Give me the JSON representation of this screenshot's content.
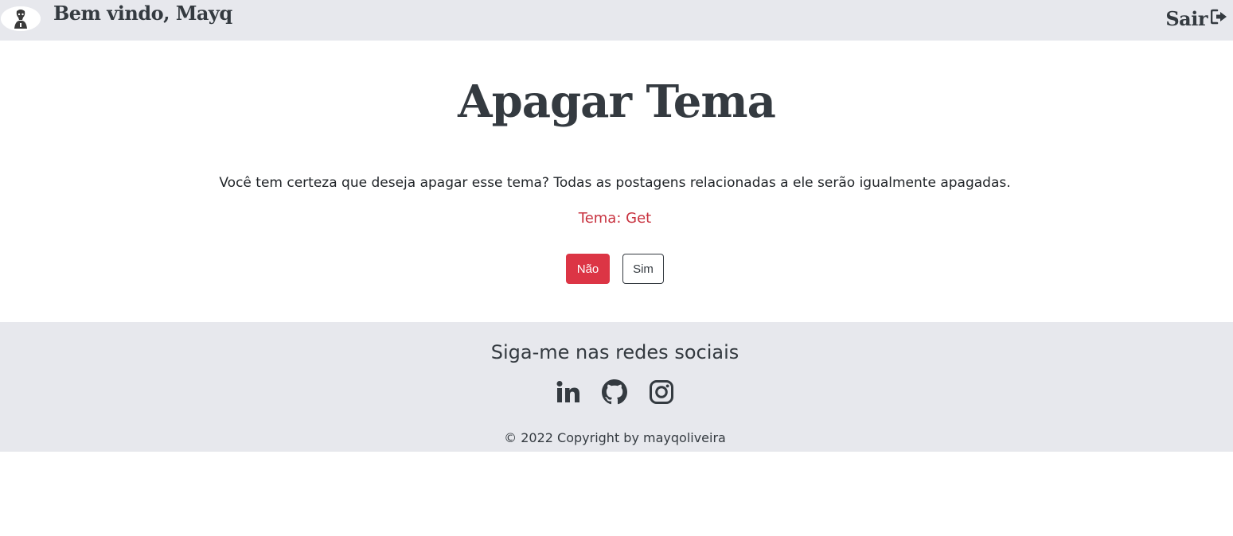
{
  "navbar": {
    "welcome": "Bem vindo, Mayq",
    "logout_label": "Sair",
    "logout_icon": "sign-out-icon",
    "avatar_icon": "user-avatar"
  },
  "main": {
    "title": "Apagar Tema",
    "question": "Você tem certeza que deseja apagar esse tema? Todas as postagens relacionadas a ele serão igualmente apagadas.",
    "theme_line": "Tema: Get",
    "buttons": {
      "no_label": "Não",
      "yes_label": "Sim"
    }
  },
  "footer": {
    "heading": "Siga-me nas redes sociais",
    "social_icons": [
      "linkedin-icon",
      "github-icon",
      "instagram-icon"
    ],
    "copyright": "© 2022 Copyright by mayqoliveira"
  },
  "colors": {
    "navbar_bg": "#e7e8ed",
    "danger": "#dc3545",
    "theme_text": "#c8323f",
    "dark": "#343a40"
  }
}
